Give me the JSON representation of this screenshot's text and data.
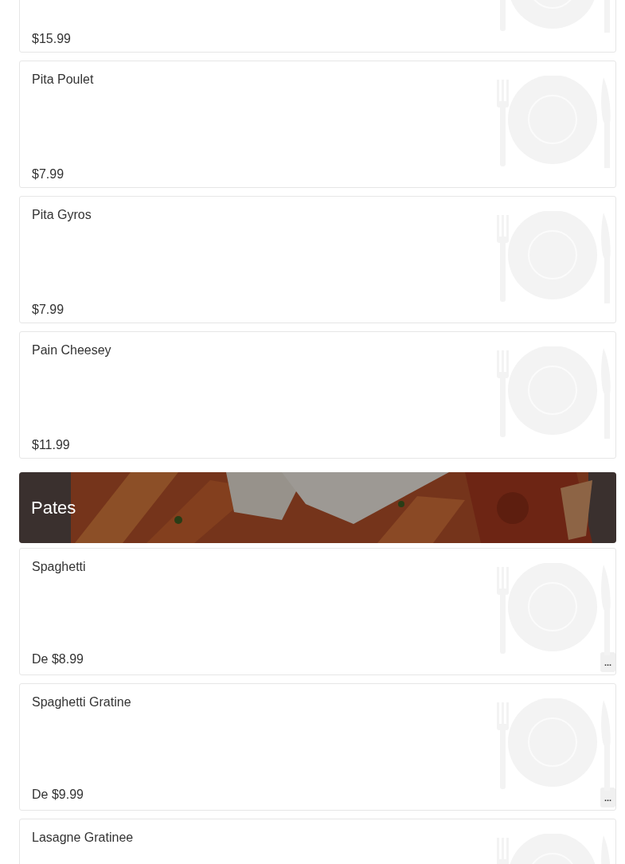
{
  "sections": [
    {
      "kind": "items",
      "items": [
        {
          "price": "$15.99"
        },
        {
          "name": "Pita Poulet",
          "price": "$7.99"
        },
        {
          "name": "Pita Gyros",
          "price": "$7.99"
        },
        {
          "name": "Pain Cheesey",
          "price": "$11.99"
        }
      ]
    },
    {
      "kind": "banner",
      "title": "Pates"
    },
    {
      "kind": "items",
      "items": [
        {
          "name": "Spaghetti",
          "price": "De $8.99",
          "more_button": "..."
        },
        {
          "name": "Spaghetti Gratine",
          "price": "De $9.99",
          "more_button": "..."
        },
        {
          "name": "Lasagne Gratinee"
        }
      ]
    }
  ]
}
